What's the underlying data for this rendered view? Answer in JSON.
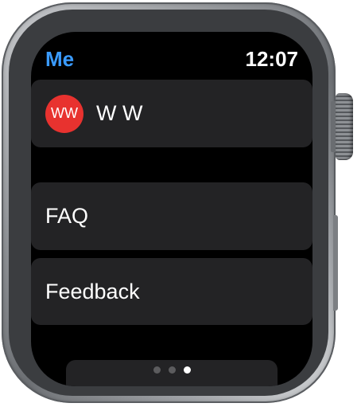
{
  "header": {
    "title": "Me",
    "time": "12:07"
  },
  "profile": {
    "initials": "WW",
    "name": "W W",
    "avatar_color": "#e8322f"
  },
  "menu": {
    "items": [
      {
        "label": "FAQ"
      },
      {
        "label": "Feedback"
      }
    ]
  },
  "page_indicator": {
    "total": 3,
    "active_index": 2
  },
  "colors": {
    "accent": "#3a9bff",
    "row_background": "#232325",
    "screen_background": "#000000"
  }
}
